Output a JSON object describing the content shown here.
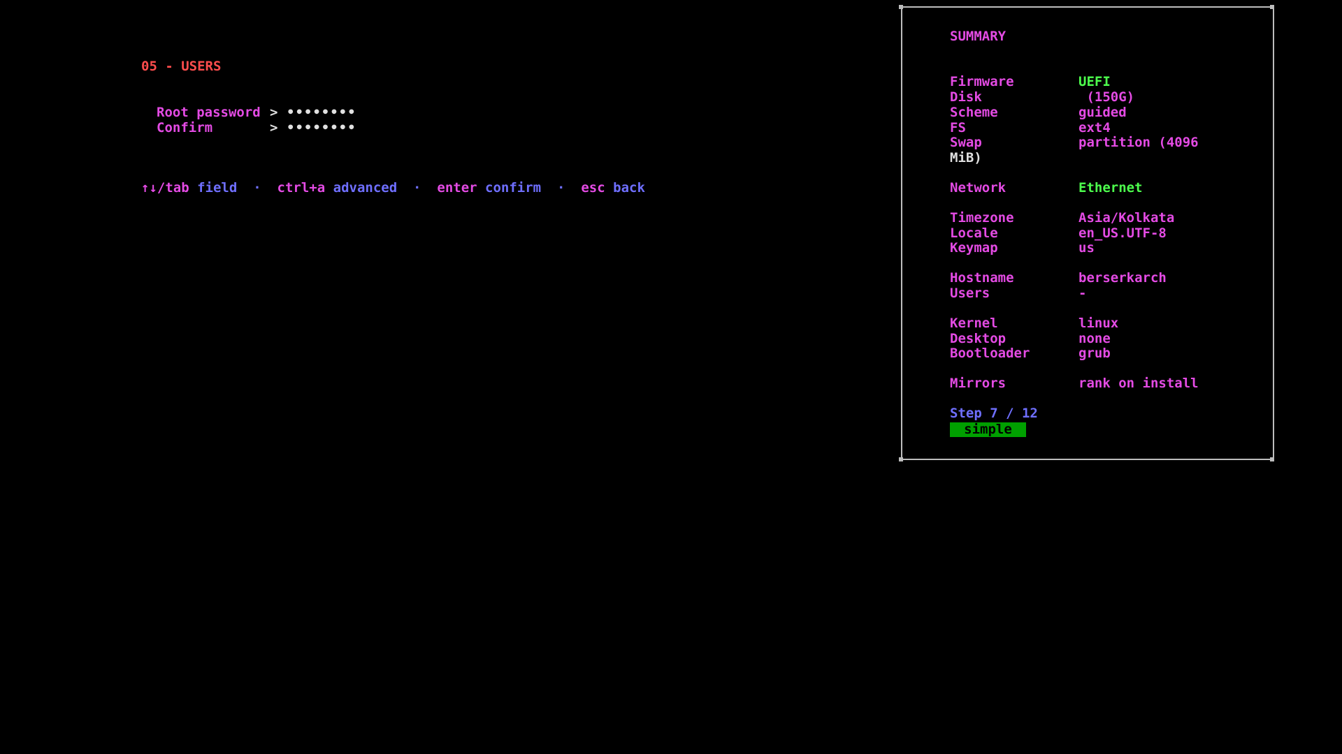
{
  "step": {
    "title": "05 - USERS",
    "fields": [
      {
        "label": "Root password",
        "arrow": ">",
        "value": "••••••••"
      },
      {
        "label": "Confirm",
        "arrow": ">",
        "value": "••••••••"
      }
    ]
  },
  "help": {
    "items": [
      {
        "key": "↑↓/tab",
        "action": "field"
      },
      {
        "key": "ctrl+a",
        "action": "advanced"
      },
      {
        "key": "enter",
        "action": "confirm"
      },
      {
        "key": "esc",
        "action": "back"
      }
    ],
    "separator": "·"
  },
  "summary": {
    "title": "SUMMARY",
    "rows": {
      "firmware": {
        "label": "Firmware",
        "value": "UEFI"
      },
      "disk": {
        "label": "Disk",
        "value": " (150G)"
      },
      "scheme": {
        "label": "Scheme",
        "value": "guided"
      },
      "fs": {
        "label": "FS",
        "value": "ext4"
      },
      "swap": {
        "label": "Swap",
        "value": "partition (4096",
        "wrap": "MiB)"
      },
      "network": {
        "label": "Network",
        "value": "Ethernet"
      },
      "timezone": {
        "label": "Timezone",
        "value": "Asia/Kolkata"
      },
      "locale": {
        "label": "Locale",
        "value": "en_US.UTF-8"
      },
      "keymap": {
        "label": "Keymap",
        "value": "us"
      },
      "hostname": {
        "label": "Hostname",
        "value": "berserkarch"
      },
      "users": {
        "label": "Users",
        "value": "-"
      },
      "kernel": {
        "label": "Kernel",
        "value": "linux"
      },
      "desktop": {
        "label": "Desktop",
        "value": "none"
      },
      "bootloader": {
        "label": "Bootloader",
        "value": "grub"
      },
      "mirrors": {
        "label": "Mirrors",
        "value": "rank on install"
      }
    },
    "step_counter": "Step 7 / 12",
    "mode": "simple"
  },
  "colors": {
    "background": "#000000",
    "magenta": "#e44be4",
    "green": "#4dff4d",
    "blue": "#6f6fff",
    "red": "#ff4d4d",
    "badge": "#00a000",
    "border": "#bdbdbd"
  }
}
